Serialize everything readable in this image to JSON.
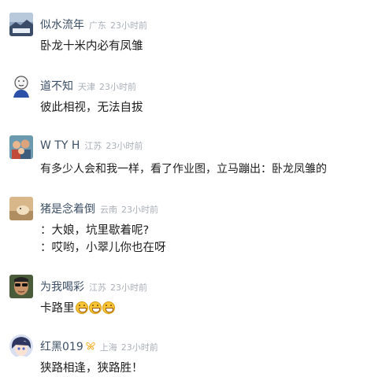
{
  "comments": [
    {
      "user": "似水流年",
      "location": "广东",
      "time": "23小时前",
      "avatar_icon": "landscape-photo-icon",
      "lines": [
        "卧龙十米内必有凤雏"
      ]
    },
    {
      "user": "道不知",
      "location": "天津",
      "time": "23小时前",
      "avatar_icon": "cartoon-face-icon",
      "lines": [
        "彼此相视，无法自拔"
      ]
    },
    {
      "user": "W TY H",
      "location": "江苏",
      "time": "23小时前",
      "avatar_icon": "family-photo-icon",
      "lines": [
        "有多少人会和我一样，看了作业图，立马蹦出：卧龙凤雏的"
      ]
    },
    {
      "user": "猪是念着倒",
      "location": "云南",
      "time": "23小时前",
      "avatar_icon": "dog-photo-icon",
      "lines": [
        "：大娘，坑里歇着呢?",
        "：哎哟，小翠儿你也在呀"
      ]
    },
    {
      "user": "为我喝彩",
      "location": "江苏",
      "time": "23小时前",
      "avatar_icon": "sunglasses-man-photo-icon",
      "lines": [
        "卡路里"
      ],
      "emoji": [
        "grin-emoji",
        "grin-emoji",
        "grin-emoji"
      ]
    },
    {
      "user": "红黑019",
      "badge_icon": "butterfly-badge-icon",
      "location": "上海",
      "time": "23小时前",
      "avatar_icon": "anime-avatar-icon",
      "lines": [
        "狭路相逢，狭路胜！"
      ]
    }
  ]
}
